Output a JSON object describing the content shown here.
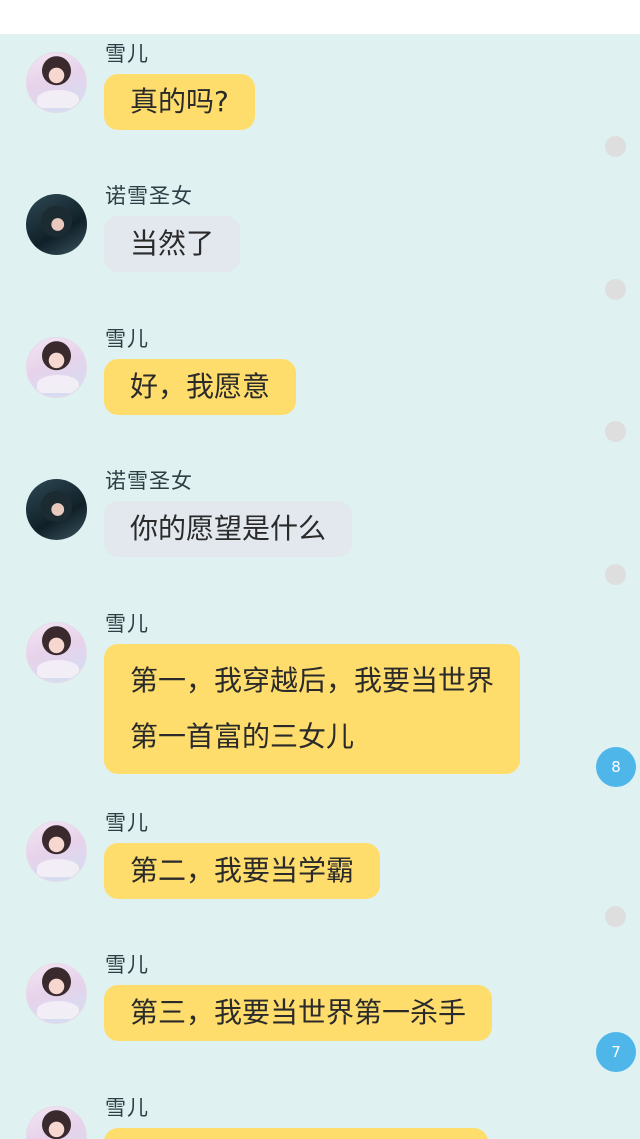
{
  "messages": [
    {
      "sender": "雪儿",
      "text": "真的吗?",
      "indicator": "dot"
    },
    {
      "sender": "诺雪圣女",
      "text": "当然了",
      "indicator": "dot"
    },
    {
      "sender": "雪儿",
      "text": "好，我愿意",
      "indicator": "dot"
    },
    {
      "sender": "诺雪圣女",
      "text": "你的愿望是什么",
      "indicator": "dot"
    },
    {
      "sender": "雪儿",
      "lines": [
        "第一，我穿越后，我要当世界",
        "第一首富的三女儿"
      ],
      "indicator": "badge",
      "badge": "8"
    },
    {
      "sender": "雪儿",
      "text": "第二，我要当学霸",
      "indicator": "dot"
    },
    {
      "sender": "雪儿",
      "text": "第三，我要当世界第一杀手",
      "indicator": "badge",
      "badge": "7"
    },
    {
      "sender": "雪儿",
      "text": ""
    }
  ],
  "colors": {
    "chat_bg": "#dff1f1",
    "own_bubble": "#fedd6d",
    "other_bubble": "#e2e8ee",
    "badge": "#4fb6ea"
  }
}
